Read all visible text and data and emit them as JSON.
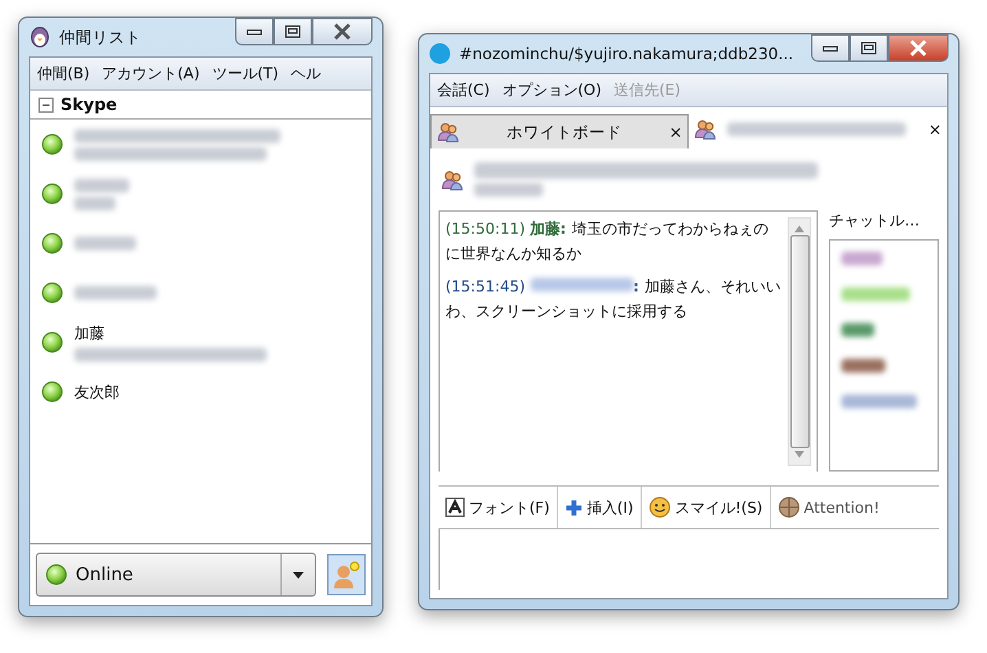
{
  "buddy_window": {
    "title": "仲間リスト",
    "menu": [
      {
        "label": "仲間(B)",
        "disabled": false
      },
      {
        "label": "アカウント(A)",
        "disabled": false
      },
      {
        "label": "ツール(T)",
        "disabled": false
      },
      {
        "label": "ヘル",
        "disabled": false
      }
    ],
    "group": {
      "name": "Skype",
      "expanded": true
    },
    "buddies": [
      {
        "name_hidden": true,
        "detail_hidden": true
      },
      {
        "name_hidden": true,
        "detail_hidden": true
      },
      {
        "name_hidden": true,
        "detail_hidden": false
      },
      {
        "name_hidden": true,
        "detail_hidden": false
      },
      {
        "name": "加藤",
        "name_hidden": false,
        "detail_hidden": true
      },
      {
        "name": "友次郎",
        "name_hidden": false,
        "detail_hidden": false
      }
    ],
    "status": {
      "label": "Online"
    }
  },
  "chat_window": {
    "title": "#nozominchu/$yujiro.nakamura;ddb230...",
    "menu": [
      {
        "label": "会話(C)",
        "disabled": false
      },
      {
        "label": "オプション(O)",
        "disabled": false
      },
      {
        "label": "送信先(E)",
        "disabled": true
      }
    ],
    "tabs": [
      {
        "label": "ホワイトボード",
        "close": "×",
        "selected": false
      },
      {
        "close": "×",
        "selected": true
      }
    ],
    "messages": [
      {
        "time": "(15:50:11)",
        "sender": "加藤:",
        "sender_hidden": false,
        "color": "#2e6b3a",
        "text": "埼玉の市だってわからねぇのに世界なんか知るか"
      },
      {
        "time": "(15:51:45)",
        "sender": ":",
        "sender_hidden": true,
        "color": "#204a87",
        "text": "加藤さん、それいいわ、スクリーンショットに採用する"
      }
    ],
    "participants_title": "チャットル…",
    "participants": [
      {
        "color": "#c8a8d0"
      },
      {
        "color": "#a8e08a"
      },
      {
        "color": "#5a9a6a"
      },
      {
        "color": "#9a7060"
      },
      {
        "color": "#a8b8d8"
      }
    ],
    "toolbar": [
      {
        "kind": "font",
        "label": "フォント(F)"
      },
      {
        "kind": "insert",
        "label": "挿入(I)"
      },
      {
        "kind": "smiley",
        "label": "スマイル!(S)"
      },
      {
        "kind": "attention",
        "label": "Attention!"
      }
    ]
  }
}
